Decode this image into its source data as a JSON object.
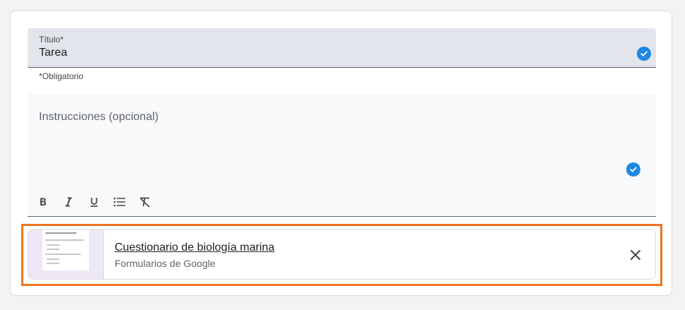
{
  "title_field": {
    "label": "Título*",
    "value": "Tarea",
    "helper": "*Obligatorio",
    "status_icon": "check-circle-icon"
  },
  "instructions_field": {
    "placeholder": "Instrucciones (opcional)",
    "status_icon": "check-circle-icon",
    "toolbar": [
      {
        "icon": "bold-icon"
      },
      {
        "icon": "italic-icon"
      },
      {
        "icon": "underline-icon"
      },
      {
        "icon": "bulleted-list-icon"
      },
      {
        "icon": "clear-formatting-icon"
      }
    ]
  },
  "attachment": {
    "title": "Cuestionario de biología marina",
    "subtitle": "Formularios de Google",
    "remove_icon": "close-icon"
  },
  "colors": {
    "accent": "#1e88e5",
    "highlight": "#f0731d",
    "thumbnail_bg": "#ede7f6"
  }
}
